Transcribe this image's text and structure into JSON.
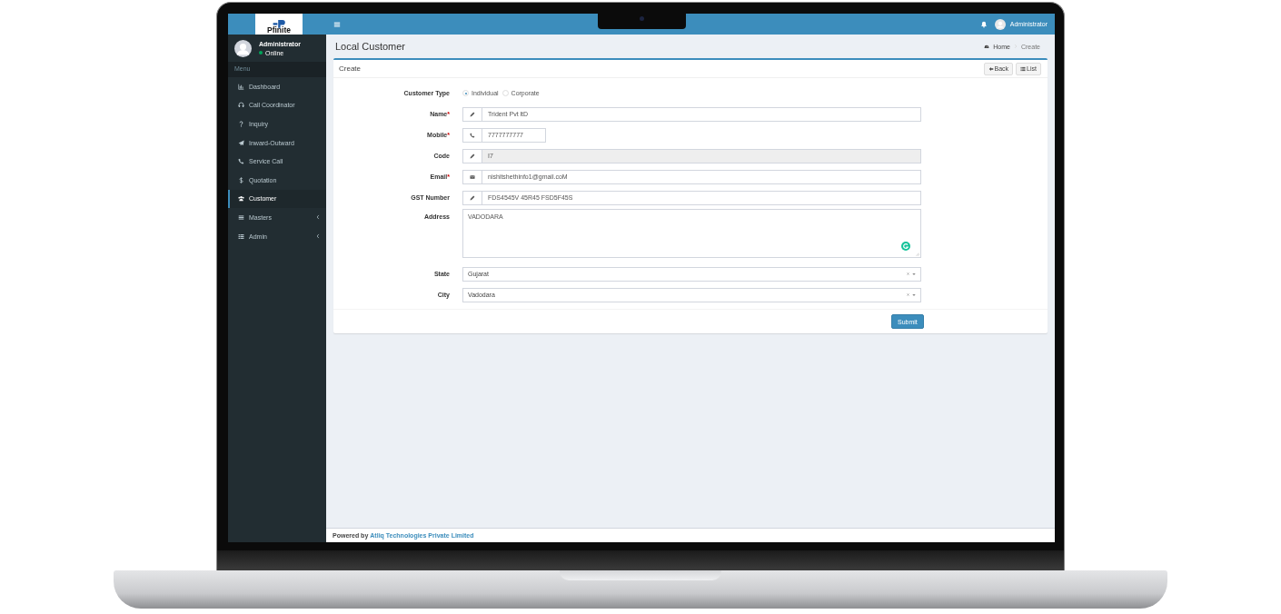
{
  "topbar": {
    "brand": "Pfinite",
    "user": "Administrator"
  },
  "sidebar": {
    "user": {
      "name": "Administrator",
      "status": "Online"
    },
    "header": "Menu",
    "items": [
      {
        "label": "Dashboard",
        "selected": false,
        "submenu": false
      },
      {
        "label": "Call Coordinator",
        "selected": false,
        "submenu": false
      },
      {
        "label": "Inquiry",
        "selected": false,
        "submenu": false
      },
      {
        "label": "Inward-Outward",
        "selected": false,
        "submenu": false
      },
      {
        "label": "Service Call",
        "selected": false,
        "submenu": false
      },
      {
        "label": "Quotation",
        "selected": false,
        "submenu": false
      },
      {
        "label": "Customer",
        "selected": true,
        "submenu": false
      },
      {
        "label": "Masters",
        "selected": false,
        "submenu": true
      },
      {
        "label": "Admin",
        "selected": false,
        "submenu": true
      }
    ]
  },
  "page": {
    "title": "Local Customer",
    "breadcrumb": [
      "Home",
      "Create"
    ]
  },
  "form": {
    "title": "Create",
    "buttons": [
      {
        "label": "Back"
      },
      {
        "label": "List"
      }
    ],
    "fields": [
      {
        "kind": "radio",
        "label": "Customer Type",
        "options": [
          {
            "label": "Individual",
            "selected": true
          },
          {
            "label": "Corporate",
            "selected": false
          }
        ]
      },
      {
        "kind": "input",
        "label": "Name",
        "required_mark": "*",
        "value": "Trident Pvt ltD",
        "disabled": false
      },
      {
        "kind": "phone",
        "label": "Mobile",
        "required_mark": "*",
        "value": "7777777777",
        "disabled": false
      },
      {
        "kind": "input",
        "label": "Code",
        "value": "I7",
        "disabled": true
      },
      {
        "kind": "email",
        "label": "Email",
        "required_mark": "*",
        "value": "nishitshethinfo1@gmail.coM",
        "disabled": false
      },
      {
        "kind": "input",
        "label": "GST Number",
        "value": "FDS4545V 45R45 FSD5F45S",
        "disabled": false
      },
      {
        "kind": "textarea",
        "label": "Address",
        "value": "VADODARA"
      },
      {
        "kind": "select",
        "label": "State",
        "value": "Gujarat"
      },
      {
        "kind": "select",
        "label": "City",
        "value": "Vadodara"
      }
    ],
    "submit": "Submit"
  },
  "footer": {
    "prefix": "Powered by",
    "link": "Atliq Technologies Private Limited"
  }
}
